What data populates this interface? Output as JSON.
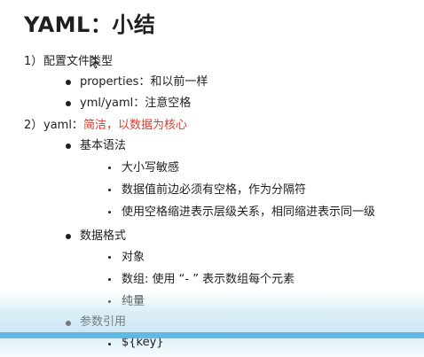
{
  "title": "YAML：小结",
  "sections": [
    {
      "number": "1）",
      "label": "配置文件类型",
      "items": [
        {
          "text": "properties：和以前一样"
        },
        {
          "text": "yml/yaml：注意空格"
        }
      ]
    },
    {
      "number": "2）",
      "label": "yaml：",
      "highlight": "简洁，以数据为核心",
      "groups": [
        {
          "label": "基本语法",
          "items": [
            "大小写敏感",
            "数据值前边必须有空格，作为分隔符",
            "使用空格缩进表示层级关系，相同缩进表示同一级"
          ]
        },
        {
          "label": "数据格式",
          "items": [
            "对象",
            "数组: 使用 “- ” 表示数组每个元素",
            "纯量"
          ]
        },
        {
          "label": "参数引用",
          "items": [
            "${key}"
          ]
        }
      ]
    }
  ],
  "colors": {
    "highlight": "#e03c2d",
    "band": "#56b5e2"
  }
}
